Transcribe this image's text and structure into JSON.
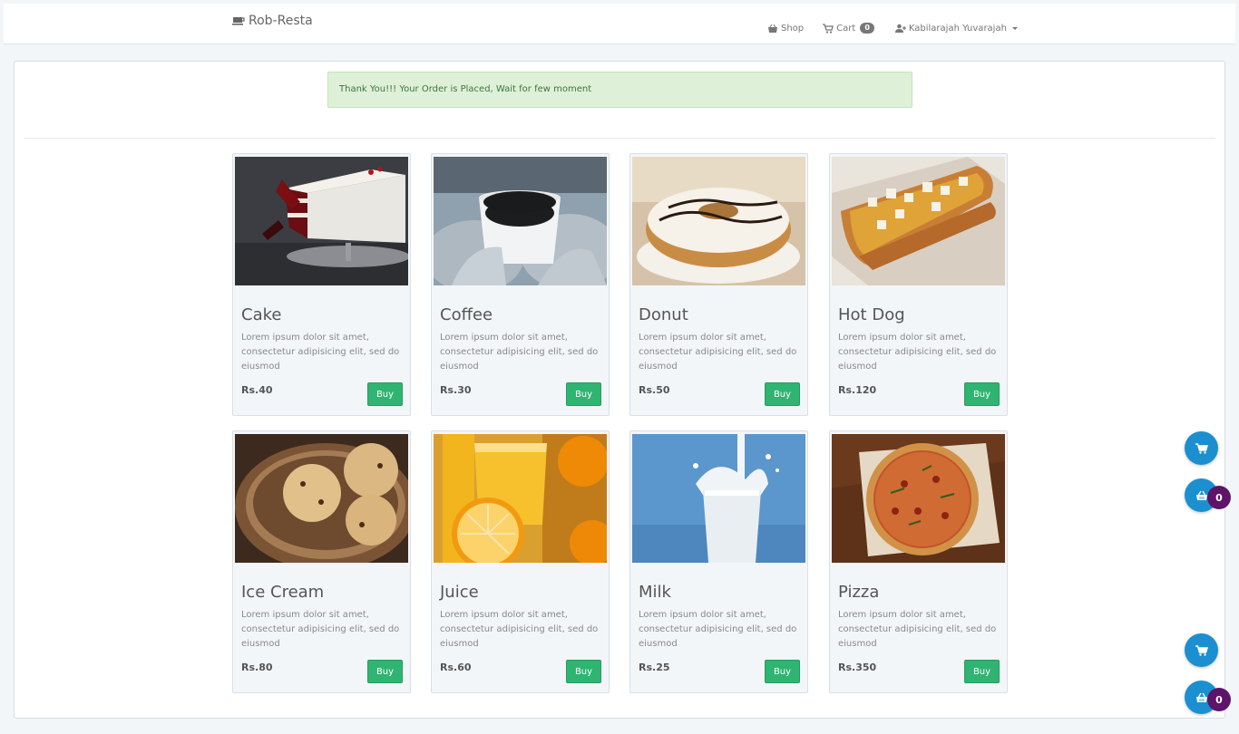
{
  "navbar": {
    "brand": "Rob-Resta",
    "shop_label": "Shop",
    "cart_label": "Cart",
    "cart_count": "0",
    "user_name": "Kabilarajah Yuvarajah"
  },
  "alert": {
    "message": "Thank You!!! Your Order is Placed, Wait for few moment"
  },
  "products": [
    {
      "name": "Cake",
      "description": "Lorem ipsum dolor sit amet, consectetur adipisicing elit, sed do eiusmod",
      "price": "Rs.40",
      "buy_label": "Buy"
    },
    {
      "name": "Coffee",
      "description": "Lorem ipsum dolor sit amet, consectetur adipisicing elit, sed do eiusmod",
      "price": "Rs.30",
      "buy_label": "Buy"
    },
    {
      "name": "Donut",
      "description": "Lorem ipsum dolor sit amet, consectetur adipisicing elit, sed do eiusmod",
      "price": "Rs.50",
      "buy_label": "Buy"
    },
    {
      "name": "Hot Dog",
      "description": "Lorem ipsum dolor sit amet, consectetur adipisicing elit, sed do eiusmod",
      "price": "Rs.120",
      "buy_label": "Buy"
    },
    {
      "name": "Ice Cream",
      "description": "Lorem ipsum dolor sit amet, consectetur adipisicing elit, sed do eiusmod",
      "price": "Rs.80",
      "buy_label": "Buy"
    },
    {
      "name": "Juice",
      "description": "Lorem ipsum dolor sit amet, consectetur adipisicing elit, sed do eiusmod",
      "price": "Rs.60",
      "buy_label": "Buy"
    },
    {
      "name": "Milk",
      "description": "Lorem ipsum dolor sit amet, consectetur adipisicing elit, sed do eiusmod",
      "price": "Rs.25",
      "buy_label": "Buy"
    },
    {
      "name": "Pizza",
      "description": "Lorem ipsum dolor sit amet, consectetur adipisicing elit, sed do eiusmod",
      "price": "Rs.350",
      "buy_label": "Buy"
    }
  ],
  "floating": {
    "basket_count_1": "0",
    "basket_count_2": "0"
  },
  "colors": {
    "alert_bg": "#dff0d8",
    "buy_button": "#2fb472",
    "fab": "#1b8fd0",
    "fab_badge": "#5e1469"
  },
  "icons": {
    "brand": "coffee-cup-icon",
    "shop": "basket-icon",
    "cart": "cart-icon",
    "user": "user-plus-icon"
  }
}
